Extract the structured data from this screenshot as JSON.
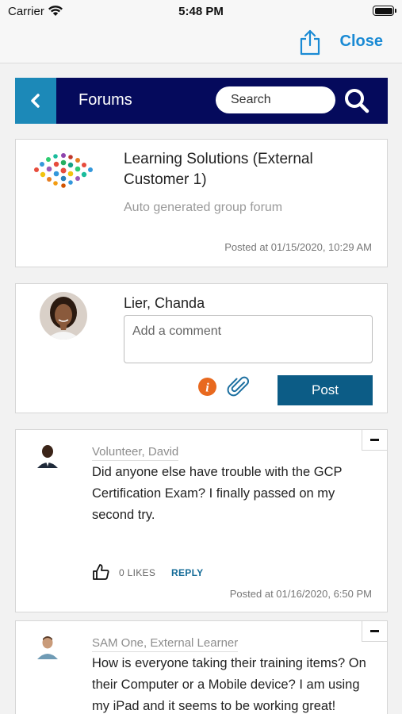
{
  "status_bar": {
    "carrier": "Carrier",
    "time": "5:48 PM",
    "battery_level": 1.0
  },
  "nav": {
    "share_icon": "share-icon",
    "close_label": "Close",
    "accent_color": "#1a8ad4"
  },
  "header": {
    "back_icon": "chevron-left-icon",
    "title": "Forums",
    "search_placeholder": "Search",
    "search_icon": "search-icon",
    "colors": {
      "bar": "#050a5c",
      "back": "#1c89b8"
    }
  },
  "group": {
    "title": "Learning Solutions (External Customer 1)",
    "description": "Auto generated group forum",
    "posted": "Posted at 01/15/2020, 10:29 AM"
  },
  "composer": {
    "user_name": "Lier, Chanda",
    "placeholder": "Add a comment",
    "info_icon": "info-icon",
    "attach_icon": "paperclip-icon",
    "post_label": "Post",
    "post_color": "#0c5c86"
  },
  "posts": [
    {
      "author": "Volunteer, David",
      "body": "Did anyone else have trouble with the GCP Certification Exam? I finally passed on my second try.",
      "likes": "0 LIKES",
      "reply": "REPLY",
      "posted": "Posted at 01/16/2020, 6:50 PM"
    },
    {
      "author": "SAM One, External Learner",
      "body": "How is everyone taking their training items? On their Computer or a Mobile device? I am using my iPad and it seems to be working great!"
    }
  ]
}
